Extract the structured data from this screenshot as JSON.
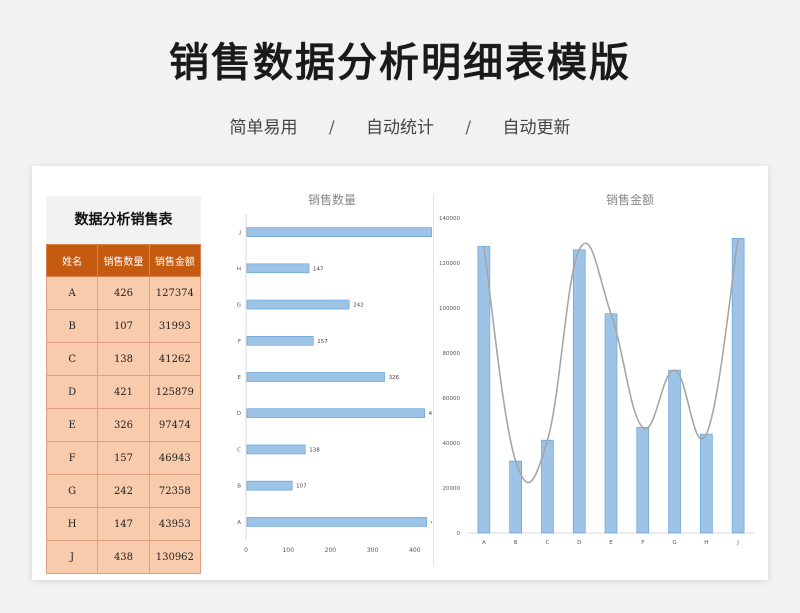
{
  "title": "销售数据分析明细表模版",
  "tagline": [
    "简单易用",
    "自动统计",
    "自动更新"
  ],
  "tagline_separator": "/",
  "table": {
    "title": "数据分析销售表",
    "headers": [
      "姓名",
      "销售数量",
      "销售金额"
    ],
    "rows": [
      [
        "A",
        "426",
        "127374"
      ],
      [
        "B",
        "107",
        "31993"
      ],
      [
        "C",
        "138",
        "41262"
      ],
      [
        "D",
        "421",
        "125879"
      ],
      [
        "E",
        "326",
        "97474"
      ],
      [
        "F",
        "157",
        "46943"
      ],
      [
        "G",
        "242",
        "72358"
      ],
      [
        "H",
        "147",
        "43953"
      ],
      [
        "J",
        "438",
        "130962"
      ]
    ]
  },
  "chart_data": [
    {
      "type": "bar",
      "orientation": "horizontal",
      "title": "销售数量",
      "categories": [
        "A",
        "B",
        "C",
        "D",
        "E",
        "F",
        "G",
        "H",
        "J"
      ],
      "values": [
        426,
        107,
        138,
        421,
        326,
        157,
        242,
        147,
        438
      ],
      "xlim": [
        0,
        500
      ],
      "xticks": [
        0,
        100,
        200,
        300,
        400,
        500
      ],
      "data_labels": true,
      "grid": false,
      "colors": {
        "bar": "#9dc3e6",
        "bar_edge": "#5b9bd5"
      }
    },
    {
      "type": "bar",
      "title": "销售金额",
      "categories": [
        "A",
        "B",
        "C",
        "D",
        "E",
        "F",
        "G",
        "H",
        "J"
      ],
      "values": [
        127374,
        31993,
        41262,
        125879,
        97474,
        46943,
        72358,
        43953,
        130962
      ],
      "ylim": [
        0,
        140000
      ],
      "yticks": [
        0,
        20000,
        40000,
        60000,
        80000,
        100000,
        120000,
        140000
      ],
      "smooth_line_overlay": true,
      "grid": false,
      "colors": {
        "bar": "#9dc3e6",
        "bar_edge": "#5b9bd5",
        "line": "#a6a6a6"
      }
    }
  ]
}
